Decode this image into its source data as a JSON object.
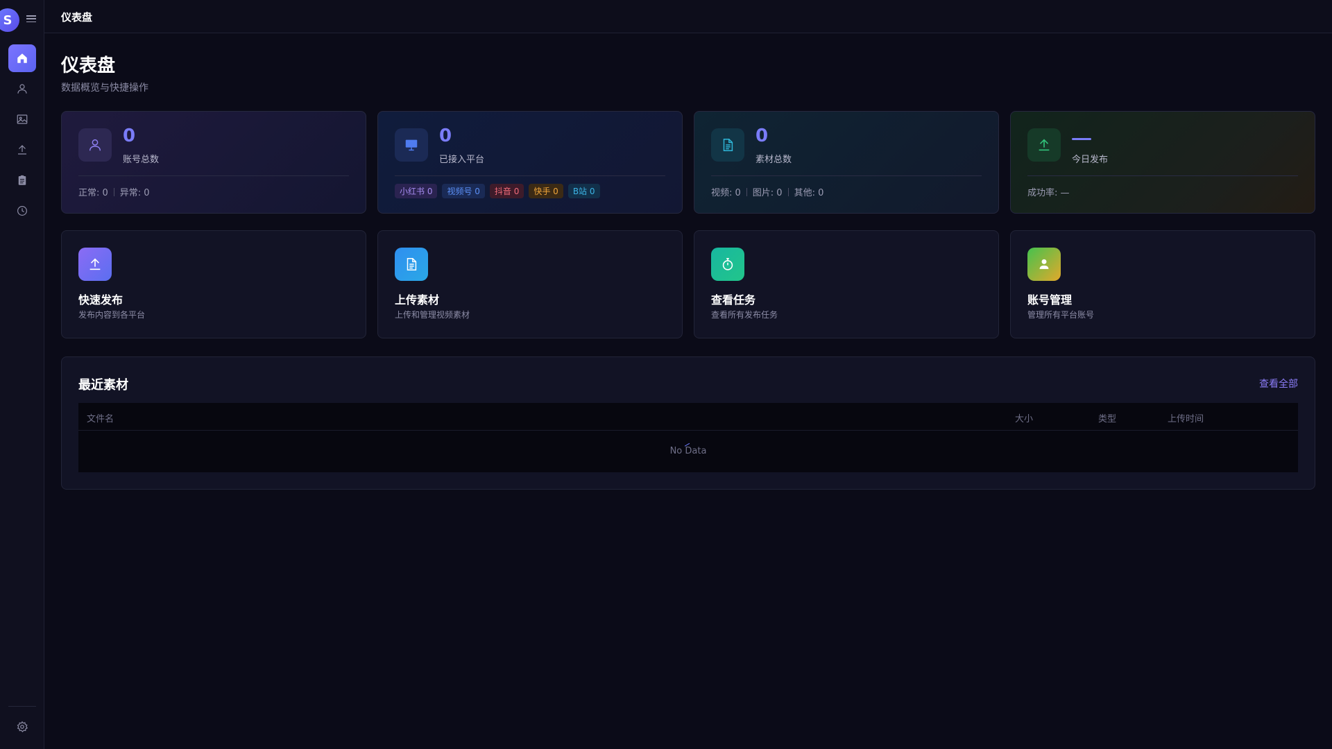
{
  "app": {
    "brand_letter": "S"
  },
  "sidebar": {
    "items": [
      {
        "icon": "home-icon",
        "active": true
      },
      {
        "icon": "user-icon"
      },
      {
        "icon": "image-icon"
      },
      {
        "icon": "upload-icon"
      },
      {
        "icon": "clipboard-icon"
      },
      {
        "icon": "clock-icon"
      }
    ],
    "footer_icon": "gear-icon"
  },
  "topbar": {
    "title": "仪表盘"
  },
  "page": {
    "title": "仪表盘",
    "subtitle": "数据概览与快捷操作"
  },
  "stats": [
    {
      "value": "0",
      "label": "账号总数",
      "footer": [
        {
          "text": "正常: 0"
        },
        {
          "text": "异常: 0"
        }
      ]
    },
    {
      "value": "0",
      "label": "已接入平台",
      "tags": [
        {
          "text": "小红书 0",
          "color": "#a58cf0",
          "bg": "#2a2350"
        },
        {
          "text": "视频号 0",
          "color": "#5b8ff5",
          "bg": "#1a2a55"
        },
        {
          "text": "抖音 0",
          "color": "#f06b7a",
          "bg": "#3d1b2a"
        },
        {
          "text": "快手 0",
          "color": "#f0a53a",
          "bg": "#3b2a15"
        },
        {
          "text": "B站 0",
          "color": "#3cb4e6",
          "bg": "#12304a"
        }
      ]
    },
    {
      "value": "0",
      "label": "素材总数",
      "footer": [
        {
          "text": "视频: 0"
        },
        {
          "text": "图片: 0"
        },
        {
          "text": "其他: 0"
        }
      ]
    },
    {
      "value": "",
      "label": "今日发布",
      "footer": [
        {
          "text": "成功率: —"
        }
      ]
    }
  ],
  "quick_actions": [
    {
      "title": "快速发布",
      "desc": "发布内容到各平台",
      "icon": "upload-icon"
    },
    {
      "title": "上传素材",
      "desc": "上传和管理视频素材",
      "icon": "document-icon"
    },
    {
      "title": "查看任务",
      "desc": "查看所有发布任务",
      "icon": "stopwatch-icon"
    },
    {
      "title": "账号管理",
      "desc": "管理所有平台账号",
      "icon": "user-icon"
    }
  ],
  "recent": {
    "title": "最近素材",
    "view_all": "查看全部",
    "columns": [
      "文件名",
      "大小",
      "类型",
      "上传时间"
    ],
    "empty_text": "No Data"
  },
  "colors": {
    "accent": "#6c6cf5",
    "background": "#0b0b18",
    "link": "#8b7cf6"
  }
}
